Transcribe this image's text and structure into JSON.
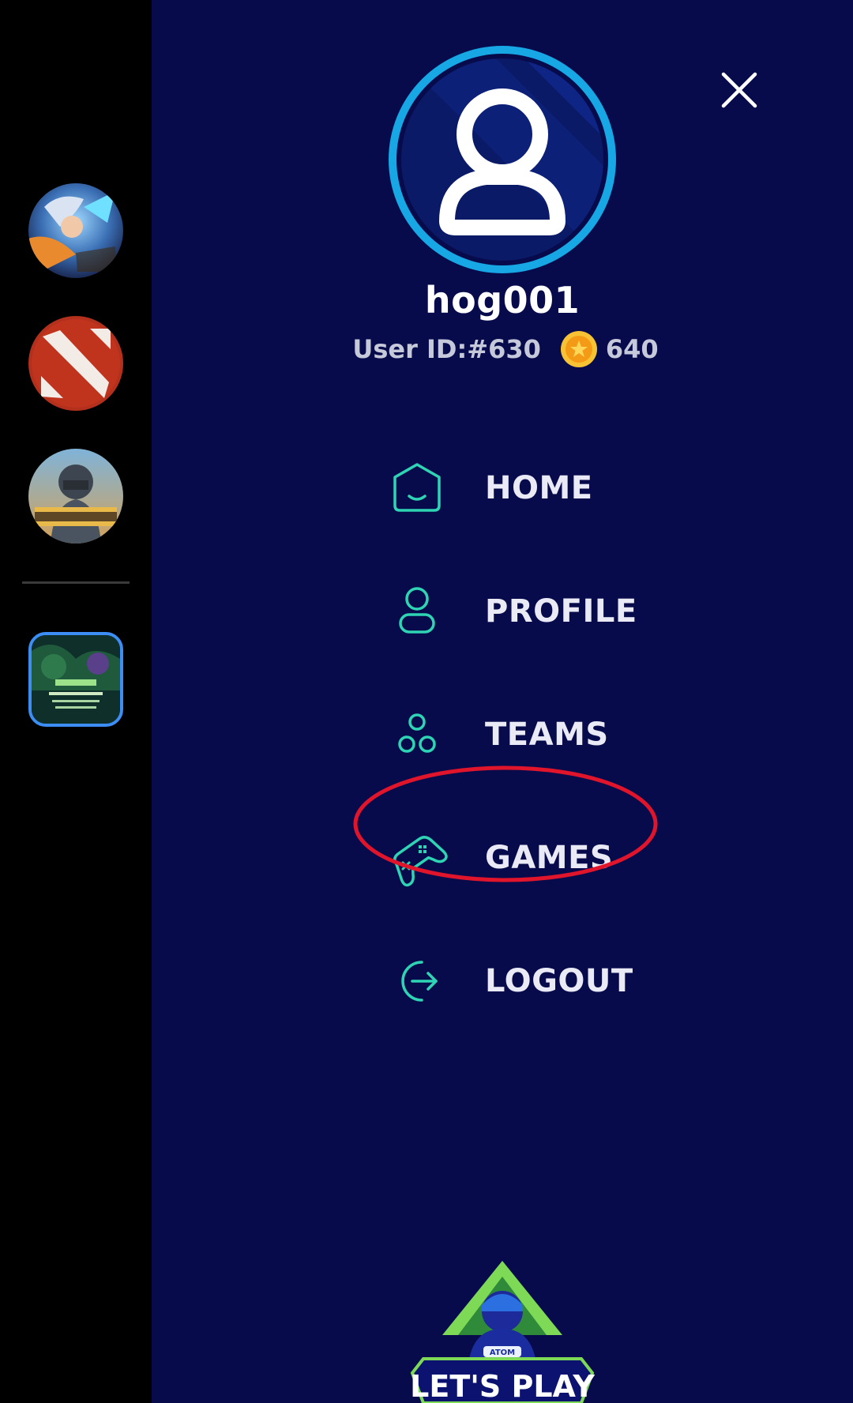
{
  "user": {
    "username": "hog001",
    "user_id_label": "User ID:#630",
    "coins": "640"
  },
  "menu": {
    "items": [
      {
        "label": "HOME",
        "icon": "home-icon"
      },
      {
        "label": "PROFILE",
        "icon": "user-icon"
      },
      {
        "label": "TEAMS",
        "icon": "teams-icon"
      },
      {
        "label": "GAMES",
        "icon": "gamepad-icon",
        "highlighted": true
      },
      {
        "label": "LOGOUT",
        "icon": "logout-icon"
      }
    ]
  },
  "sidebar": {
    "games": [
      {
        "icon": "mobile-legends-icon"
      },
      {
        "icon": "dota2-icon"
      },
      {
        "icon": "pubg-icon"
      }
    ],
    "event": {
      "icon": "weekend-battle-thumbnail"
    }
  },
  "brand": {
    "logo_text": "LET'S PLAY",
    "logo_badge": "ATOM"
  },
  "colors": {
    "drawer_bg": "#070b4b",
    "accent_teal": "#2ed4b4",
    "avatar_ring": "#16a7e4",
    "highlight_red": "#e0152b",
    "coin_gold": "#f4a21a"
  }
}
